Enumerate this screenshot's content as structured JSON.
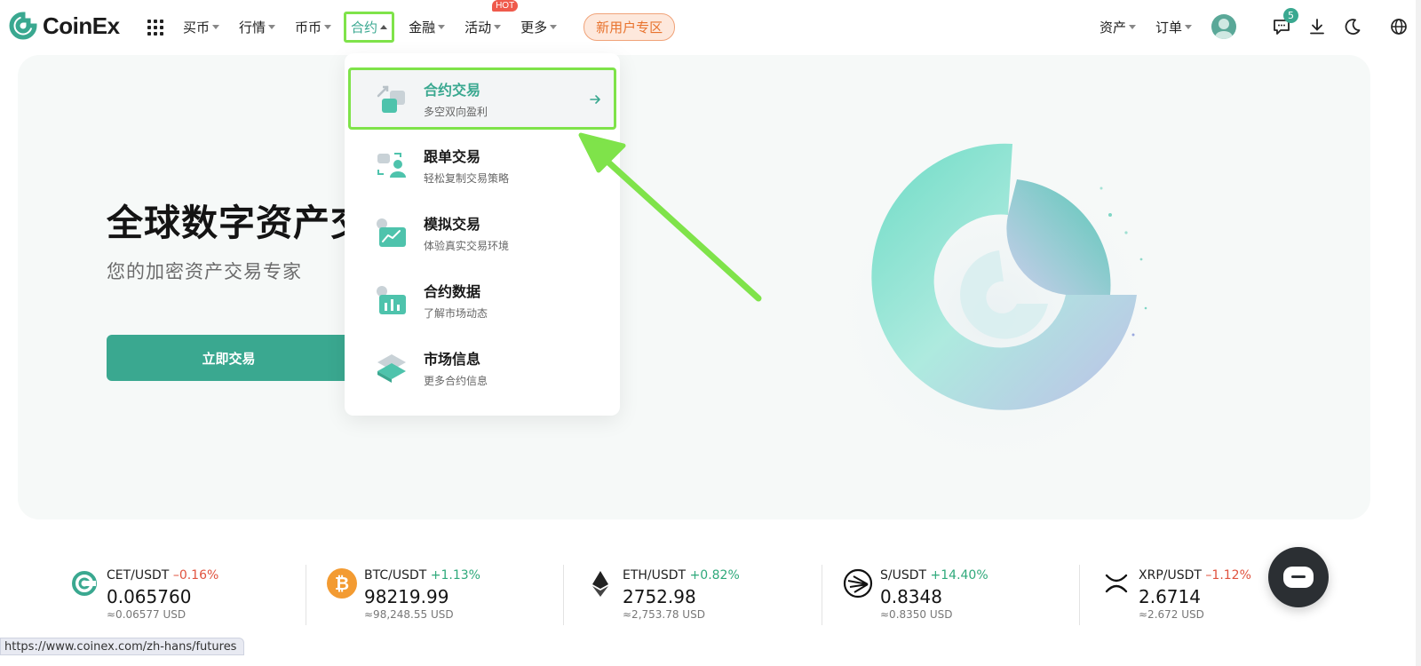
{
  "brand": {
    "name": "CoinEx",
    "accent": "#3aa890",
    "promo_color": "#e8732e",
    "highlight": "#7fe34a"
  },
  "nav": {
    "items": [
      {
        "label": "买币",
        "caret": "down"
      },
      {
        "label": "行情",
        "caret": "down"
      },
      {
        "label": "币币",
        "caret": "down"
      },
      {
        "label": "合约",
        "caret": "up",
        "active": true
      },
      {
        "label": "金融",
        "caret": "down"
      },
      {
        "label": "活动",
        "caret": "down",
        "badge": "HOT"
      },
      {
        "label": "更多",
        "caret": "down"
      }
    ],
    "promo": "新用户专区",
    "right": {
      "assets": "资产",
      "orders": "订单",
      "message_count": "5"
    }
  },
  "dropdown": {
    "items": [
      {
        "title": "合约交易",
        "subtitle": "多空双向盈利",
        "icon": "futures-trade-icon"
      },
      {
        "title": "跟单交易",
        "subtitle": "轻松复制交易策略",
        "icon": "copy-trade-icon"
      },
      {
        "title": "模拟交易",
        "subtitle": "体验真实交易环境",
        "icon": "demo-trade-icon"
      },
      {
        "title": "合约数据",
        "subtitle": "了解市场动态",
        "icon": "futures-data-icon"
      },
      {
        "title": "市场信息",
        "subtitle": "更多合约信息",
        "icon": "market-info-icon"
      }
    ]
  },
  "hero": {
    "title": "全球数字资产交",
    "subtitle": "您的加密资产交易专家",
    "cta": "立即交易"
  },
  "ticker": [
    {
      "pair": "CET/USDT",
      "change": "–0.16%",
      "direction": "down",
      "price": "0.065760",
      "usd": "≈0.06577 USD"
    },
    {
      "pair": "BTC/USDT",
      "change": "+1.13%",
      "direction": "up",
      "price": "98219.99",
      "usd": "≈98,248.55 USD"
    },
    {
      "pair": "ETH/USDT",
      "change": "+0.82%",
      "direction": "up",
      "price": "2752.98",
      "usd": "≈2,753.78 USD"
    },
    {
      "pair": "S/USDT",
      "change": "+14.40%",
      "direction": "up",
      "price": "0.8348",
      "usd": "≈0.8350 USD"
    },
    {
      "pair": "XRP/USDT",
      "change": "–1.12%",
      "direction": "down",
      "price": "2.6714",
      "usd": "≈2.672 USD"
    }
  ],
  "status_url": "https://www.coinex.com/zh-hans/futures"
}
